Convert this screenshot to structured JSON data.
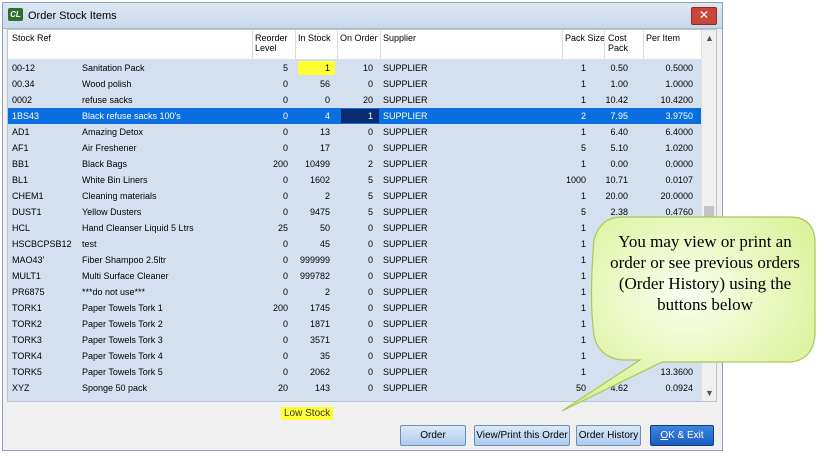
{
  "window": {
    "title": "Order Stock Items",
    "app_icon_text": "CL"
  },
  "columns": {
    "stock_ref": "Stock Ref",
    "reorder_level": "Reorder\nLevel",
    "in_stock": "In Stock",
    "on_order": "On Order",
    "supplier": "Supplier",
    "pack_size": "Pack Size",
    "cost_pack": "Cost\nPack",
    "per_item": "Per Item"
  },
  "rows": [
    {
      "ref": "00-12",
      "desc": "Sanitation Pack",
      "reorder": "5",
      "in_stock": "1",
      "on_order": "10",
      "supplier": "SUPPLIER",
      "pack": "1",
      "cost": "0.50",
      "per": "0.5000",
      "low": true
    },
    {
      "ref": "00.34",
      "desc": "Wood polish",
      "reorder": "0",
      "in_stock": "56",
      "on_order": "0",
      "supplier": "SUPPLIER",
      "pack": "1",
      "cost": "1.00",
      "per": "1.0000"
    },
    {
      "ref": "0002",
      "desc": "refuse sacks",
      "reorder": "0",
      "in_stock": "0",
      "on_order": "20",
      "supplier": "SUPPLIER",
      "pack": "1",
      "cost": "10.42",
      "per": "10.4200"
    },
    {
      "ref": "1BS43",
      "desc": "Black refuse sacks 100's",
      "reorder": "0",
      "in_stock": "4",
      "on_order": "1",
      "supplier": "SUPPLIER",
      "pack": "2",
      "cost": "7.95",
      "per": "3.9750",
      "selected": true
    },
    {
      "ref": "AD1",
      "desc": "Amazing Detox",
      "reorder": "0",
      "in_stock": "13",
      "on_order": "0",
      "supplier": "SUPPLIER",
      "pack": "1",
      "cost": "6.40",
      "per": "6.4000"
    },
    {
      "ref": "AF1",
      "desc": "Air Freshener",
      "reorder": "0",
      "in_stock": "17",
      "on_order": "0",
      "supplier": "SUPPLIER",
      "pack": "5",
      "cost": "5.10",
      "per": "1.0200"
    },
    {
      "ref": "BB1",
      "desc": "Black Bags",
      "reorder": "200",
      "in_stock": "10499",
      "on_order": "2",
      "supplier": "SUPPLIER",
      "pack": "1",
      "cost": "0.00",
      "per": "0.0000"
    },
    {
      "ref": "BL1",
      "desc": "White Bin Liners",
      "reorder": "0",
      "in_stock": "1602",
      "on_order": "5",
      "supplier": "SUPPLIER",
      "pack": "1000",
      "cost": "10.71",
      "per": "0.0107"
    },
    {
      "ref": "CHEM1",
      "desc": "Cleaning materials",
      "reorder": "0",
      "in_stock": "2",
      "on_order": "5",
      "supplier": "SUPPLIER",
      "pack": "1",
      "cost": "20.00",
      "per": "20.0000"
    },
    {
      "ref": "DUST1",
      "desc": "Yellow Dusters",
      "reorder": "0",
      "in_stock": "9475",
      "on_order": "5",
      "supplier": "SUPPLIER",
      "pack": "5",
      "cost": "2.38",
      "per": "0.4760"
    },
    {
      "ref": "HCL",
      "desc": "Hand Cleanser Liquid 5 Ltrs",
      "reorder": "25",
      "in_stock": "50",
      "on_order": "0",
      "supplier": "SUPPLIER",
      "pack": "1",
      "cost": "",
      "per": ""
    },
    {
      "ref": "HSCBCPSB12",
      "desc": "test",
      "reorder": "0",
      "in_stock": "45",
      "on_order": "0",
      "supplier": "SUPPLIER",
      "pack": "1",
      "cost": "",
      "per": ""
    },
    {
      "ref": "MAO43'",
      "desc": "Fiber Shampoo 2.5ltr",
      "reorder": "0",
      "in_stock": "999999",
      "on_order": "0",
      "supplier": "SUPPLIER",
      "pack": "1",
      "cost": "",
      "per": ""
    },
    {
      "ref": "MULT1",
      "desc": "Multi Surface Cleaner",
      "reorder": "0",
      "in_stock": "999782",
      "on_order": "0",
      "supplier": "SUPPLIER",
      "pack": "1",
      "cost": "",
      "per": ""
    },
    {
      "ref": "PR6875",
      "desc": "***do not use***",
      "reorder": "0",
      "in_stock": "2",
      "on_order": "0",
      "supplier": "SUPPLIER",
      "pack": "1",
      "cost": "",
      "per": ""
    },
    {
      "ref": "TORK1",
      "desc": "Paper Towels Tork 1",
      "reorder": "200",
      "in_stock": "1745",
      "on_order": "0",
      "supplier": "SUPPLIER",
      "pack": "1",
      "cost": "",
      "per": ""
    },
    {
      "ref": "TORK2",
      "desc": "Paper Towels Tork 2",
      "reorder": "0",
      "in_stock": "1871",
      "on_order": "0",
      "supplier": "SUPPLIER",
      "pack": "1",
      "cost": "",
      "per": ""
    },
    {
      "ref": "TORK3",
      "desc": "Paper Towels Tork 3",
      "reorder": "0",
      "in_stock": "3571",
      "on_order": "0",
      "supplier": "SUPPLIER",
      "pack": "1",
      "cost": "",
      "per": ""
    },
    {
      "ref": "TORK4",
      "desc": "Paper Towels Tork 4",
      "reorder": "0",
      "in_stock": "35",
      "on_order": "0",
      "supplier": "SUPPLIER",
      "pack": "1",
      "cost": "",
      "per": ""
    },
    {
      "ref": "TORK5",
      "desc": "Paper Towels Tork 5",
      "reorder": "0",
      "in_stock": "2062",
      "on_order": "0",
      "supplier": "SUPPLIER",
      "pack": "1",
      "cost": "",
      "per": "13.3600"
    },
    {
      "ref": "XYZ",
      "desc": "Sponge 50 pack",
      "reorder": "20",
      "in_stock": "143",
      "on_order": "0",
      "supplier": "SUPPLIER",
      "pack": "50",
      "cost": "4.62",
      "per": "0.0924"
    }
  ],
  "legend": {
    "low_stock": "Low Stock"
  },
  "buttons": {
    "order": "Order",
    "view_print": "View/Print this Order",
    "order_history": "Order History",
    "ok_exit_prefix": "O",
    "ok_exit_rest": "K & Exit"
  },
  "callout": {
    "text": "You may view or print an order or see previous orders (Order History) using the buttons below"
  },
  "colors": {
    "row_background": "#d4e0ef",
    "selected_row": "#0a6ee0",
    "low_stock_highlight": "#ffff33",
    "callout_fill": "#e6f7a8",
    "close_button": "#c9463d"
  }
}
